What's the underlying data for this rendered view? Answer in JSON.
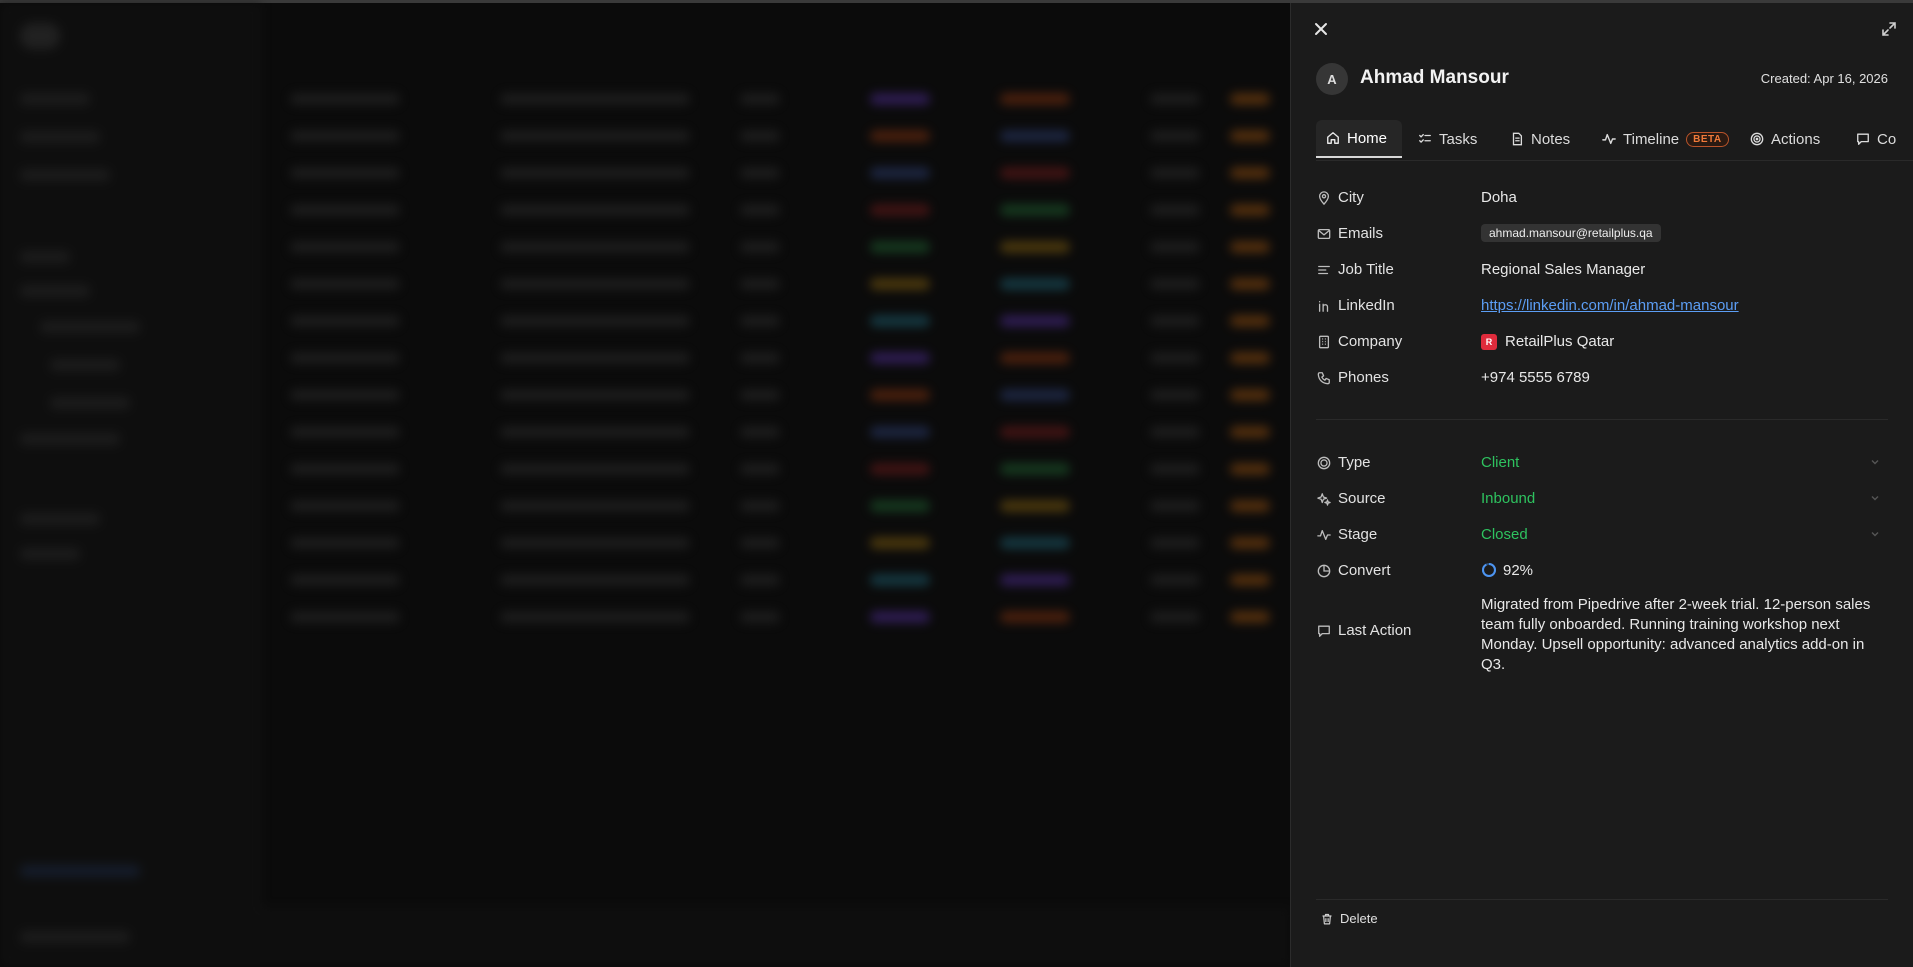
{
  "drawer": {
    "avatar_initial": "A",
    "name": "Ahmad Mansour",
    "created": "Created: Apr 16, 2026",
    "tabs": [
      {
        "label": "Home",
        "icon": "home-icon",
        "active": true
      },
      {
        "label": "Tasks",
        "icon": "tasks-icon"
      },
      {
        "label": "Notes",
        "icon": "notes-icon"
      },
      {
        "label": "Timeline",
        "icon": "timeline-icon",
        "badge": "BETA"
      },
      {
        "label": "Actions",
        "icon": "target-icon"
      },
      {
        "label": "Co",
        "icon": "comment-icon"
      }
    ],
    "fields": {
      "city": {
        "label": "City",
        "value": "Doha"
      },
      "emails": {
        "label": "Emails",
        "value": "ahmad.mansour@retailplus.qa"
      },
      "job_title": {
        "label": "Job Title",
        "value": "Regional Sales Manager"
      },
      "linkedin": {
        "label": "LinkedIn",
        "value": "https://linkedin.com/in/ahmad-mansour"
      },
      "company": {
        "label": "Company",
        "value": "RetailPlus Qatar",
        "logo_letter": "R",
        "logo_color": "#e02b3c"
      },
      "phones": {
        "label": "Phones",
        "value": "+974 5555 6789"
      },
      "type": {
        "label": "Type",
        "value": "Client"
      },
      "source": {
        "label": "Source",
        "value": "Inbound"
      },
      "stage": {
        "label": "Stage",
        "value": "Closed"
      },
      "convert": {
        "label": "Convert",
        "value": "92%"
      },
      "last_action": {
        "label": "Last Action",
        "value": "Migrated from Pipedrive after 2-week trial. 12-person sales team fully onboarded. Running training workshop next Monday. Upsell opportunity: advanced analytics add-on in Q3."
      }
    },
    "delete_label": "Delete",
    "accent_green": "#2ec25f",
    "link_color": "#5c9ef5"
  }
}
